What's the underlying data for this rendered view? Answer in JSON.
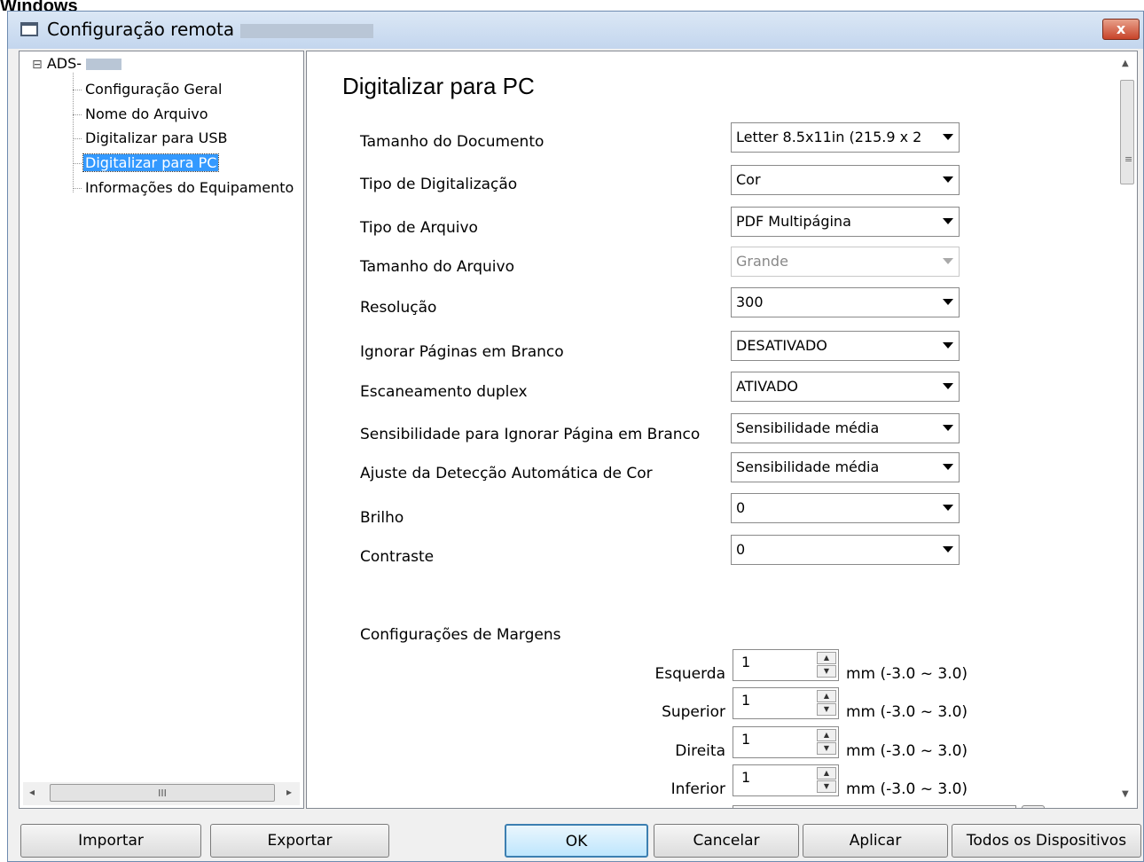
{
  "caption": "Windows",
  "window": {
    "title": "Configuração remota -",
    "close_label": "x"
  },
  "tree": {
    "root_label": "ADS-",
    "expander": "⊟",
    "items": [
      {
        "label": "Configuração Geral"
      },
      {
        "label": "Nome do Arquivo"
      },
      {
        "label": "Digitalizar para USB"
      },
      {
        "label": "Digitalizar para PC",
        "selected": true
      },
      {
        "label": "Informações do Equipamento"
      }
    ],
    "hscroll_grip": "III"
  },
  "content": {
    "heading": "Digitalizar para PC",
    "settings": [
      {
        "label": "Tamanho do Documento",
        "value": "Letter 8.5x11in (215.9 x 2"
      },
      {
        "label": "Tipo de Digitalização",
        "value": "Cor"
      },
      {
        "label": "Tipo de Arquivo",
        "value": "PDF Multipágina"
      },
      {
        "label": "Tamanho do Arquivo",
        "value": "Grande",
        "disabled": true
      },
      {
        "label": "Resolução",
        "value": "300"
      },
      {
        "label": "Ignorar Páginas em Branco",
        "value": "DESATIVADO"
      },
      {
        "label": "Escaneamento duplex",
        "value": "ATIVADO"
      },
      {
        "label": "Sensibilidade para Ignorar Página em Branco",
        "value": "Sensibilidade média"
      },
      {
        "label": "Ajuste da Detecção Automática de Cor",
        "value": "Sensibilidade média"
      },
      {
        "label": "Brilho",
        "value": "0"
      },
      {
        "label": "Contraste",
        "value": "0"
      }
    ],
    "margins": {
      "title": "Configurações de Margens",
      "unit": "mm (-3.0 ~ 3.0)",
      "fields": [
        {
          "label": "Esquerda",
          "value": "1"
        },
        {
          "label": "Superior",
          "value": "1"
        },
        {
          "label": "Direita",
          "value": "1"
        },
        {
          "label": "Inferior",
          "value": "1"
        }
      ]
    }
  },
  "buttons": {
    "import": "Importar",
    "export": "Exportar",
    "ok": "OK",
    "cancel": "Cancelar",
    "apply": "Aplicar",
    "all_devices": "Todos os Dispositivos"
  },
  "colors": {
    "selection": "#3399ff",
    "close": "#c8442a",
    "default_button_border": "#3c7fb1"
  }
}
